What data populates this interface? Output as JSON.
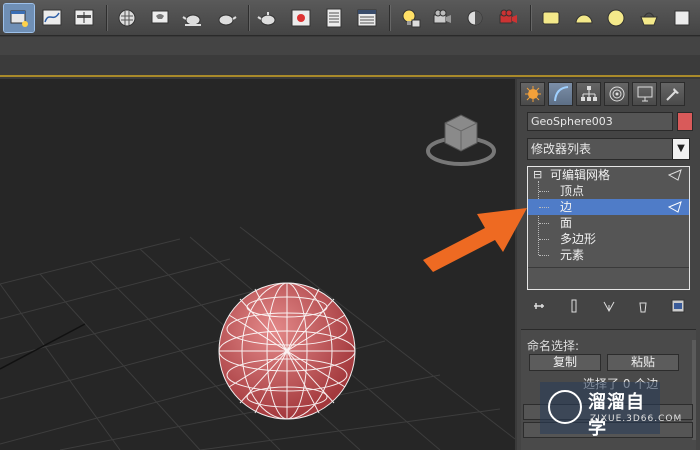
{
  "toolbar": {
    "icons": [
      "file-icon",
      "curve-editor-icon",
      "dope-sheet-icon",
      "material-editor-icon",
      "render-setup-icon",
      "teapot-icon",
      "teapot-icon",
      "teapot-icon",
      "render-frame-icon",
      "listing-icon",
      "listing-icon",
      "light-bulb-icon",
      "camera-icon",
      "render-icon",
      "render-icon",
      "rectangle-icon",
      "hemisphere-icon",
      "sphere-icon",
      "basket-icon",
      "more-icon"
    ]
  },
  "panel": {
    "tabs": [
      "create-tab",
      "modify-tab",
      "hierarchy-tab",
      "motion-tab",
      "display-tab",
      "utilities-tab"
    ],
    "object_name": "GeoSphere003",
    "object_color": "#d95a5a",
    "modifier_list": "修改器列表",
    "modifier_list_arrow": "▼",
    "stack": {
      "root": "可编辑网格",
      "root_expander": "⊟",
      "items": [
        "顶点",
        "边",
        "面",
        "多边形",
        "元素"
      ],
      "selected_index": 1
    },
    "rollout": {
      "title": "命名选择:",
      "copy_label": "复制",
      "paste_label": "粘贴",
      "selection_info": "选择了 0 个边"
    }
  },
  "watermark": {
    "name": "溜溜自学",
    "url": "ZIXUE.3D66.COM"
  },
  "colors": {
    "accent_selected": "#4f7cc8",
    "annotation_arrow": "#ee6a22",
    "sphere": "#c9595c"
  }
}
